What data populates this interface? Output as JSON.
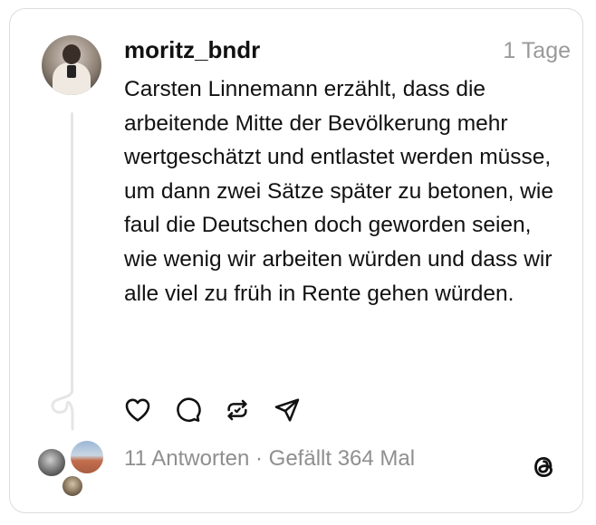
{
  "post": {
    "username": "moritz_bndr",
    "time": "1 Tage",
    "text": "Carsten Linnemann erzählt, dass die arbeitende Mitte der Bevölkerung mehr wertgeschätzt und entlastet werden müsse, um dann zwei Sätze später zu betonen, wie faul die Deutschen doch geworden seien, wie wenig wir arbeiten würden und dass wir alle viel zu früh in Rente gehen würden."
  },
  "actions": {
    "icons": [
      "heart-icon",
      "comment-icon",
      "repost-icon",
      "share-icon"
    ]
  },
  "stats": {
    "replies": "11 Antworten",
    "separator": " · ",
    "likes": "Gefällt 364 Mal"
  },
  "colors": {
    "text": "#111111",
    "muted": "#9a9a9a",
    "border": "#dcdcdc",
    "thread_line": "#e6e6e6"
  }
}
